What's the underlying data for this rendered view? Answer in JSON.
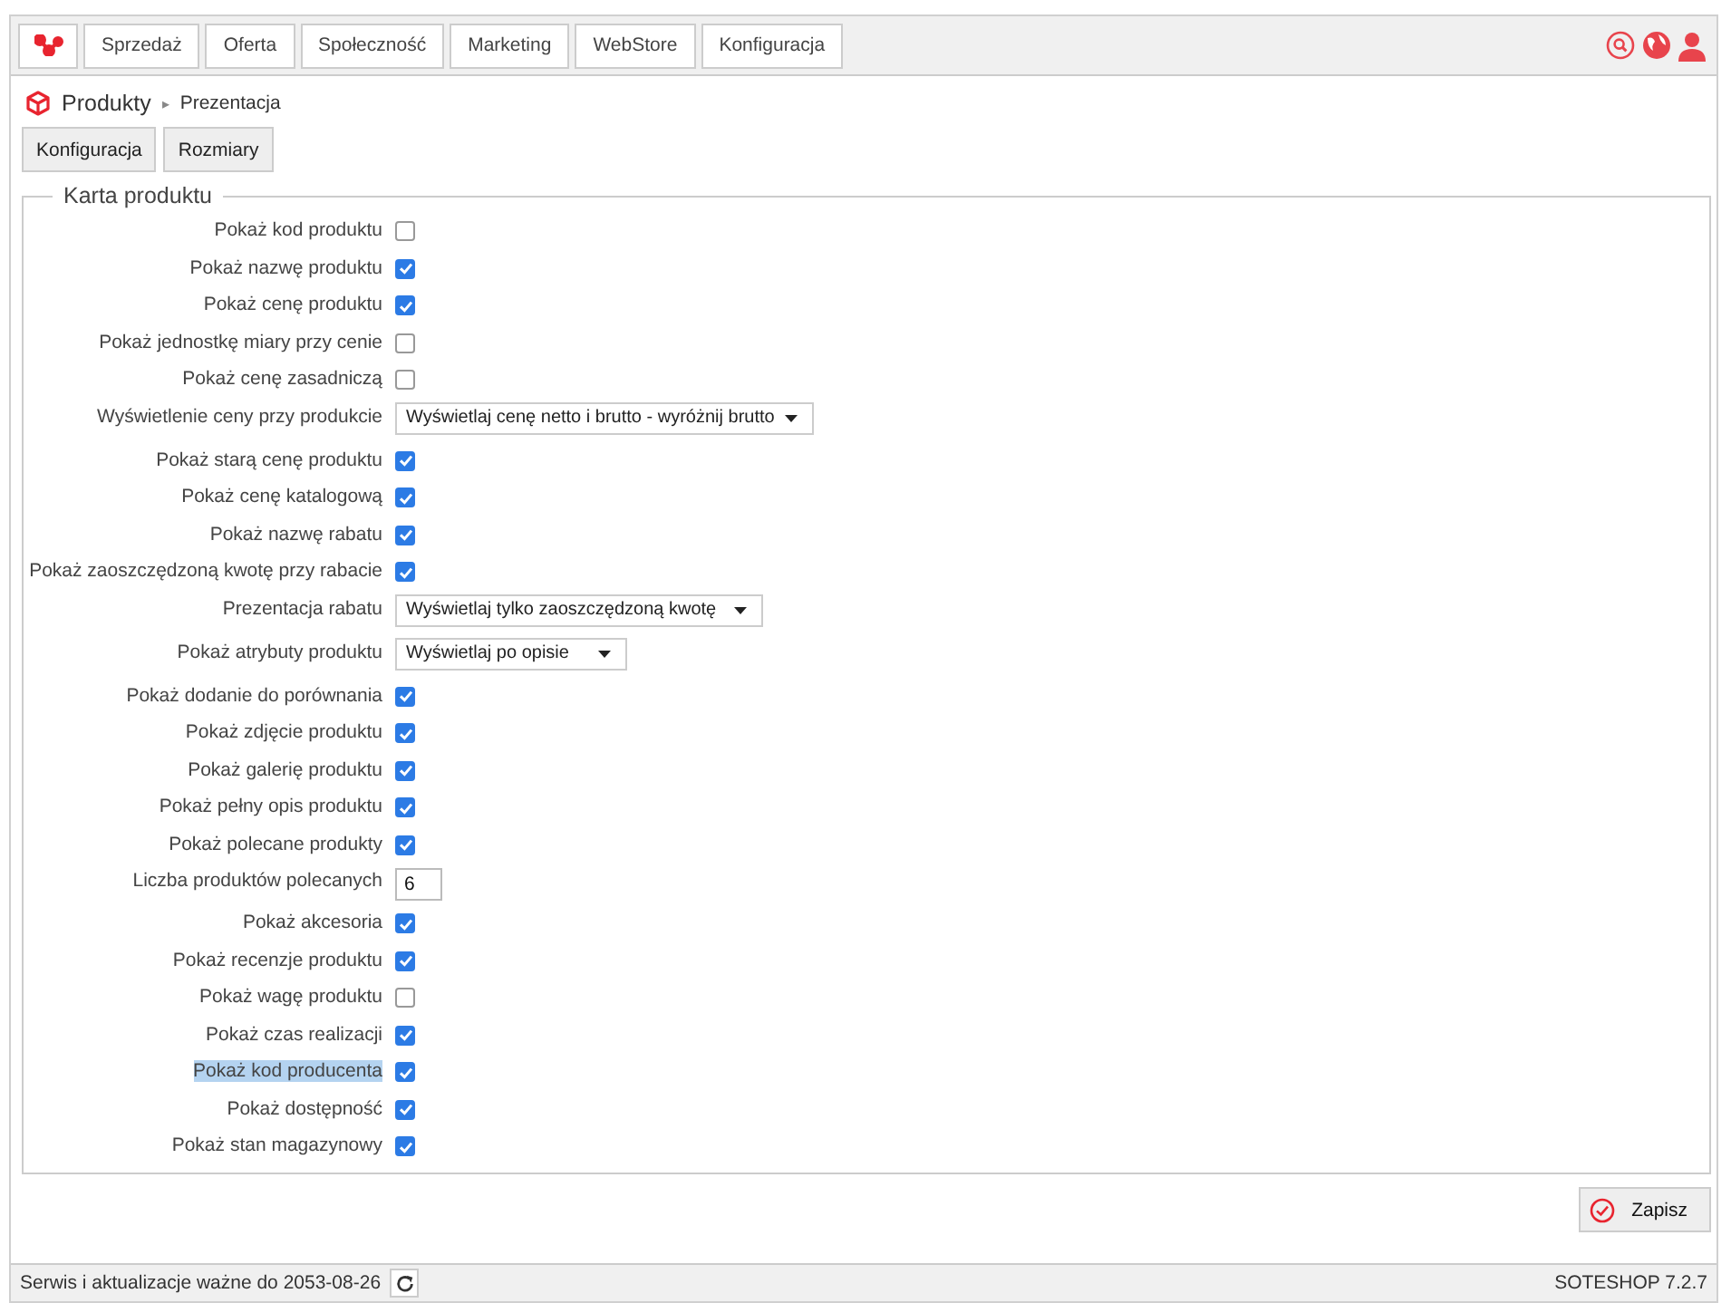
{
  "nav": {
    "items": [
      {
        "label": "Sprzedaż"
      },
      {
        "label": "Oferta"
      },
      {
        "label": "Społeczność"
      },
      {
        "label": "Marketing"
      },
      {
        "label": "WebStore"
      },
      {
        "label": "Konfiguracja"
      }
    ]
  },
  "breadcrumb": {
    "section": "Produkty",
    "separator": "▸",
    "page": "Prezentacja"
  },
  "subtabs": [
    {
      "label": "Konfiguracja"
    },
    {
      "label": "Rozmiary"
    }
  ],
  "fieldset": {
    "legend": "Karta produktu",
    "rows": [
      {
        "kind": "checkbox",
        "label": "Pokaż kod produktu",
        "checked": false,
        "highlighted": false
      },
      {
        "kind": "checkbox",
        "label": "Pokaż nazwę produktu",
        "checked": true,
        "highlighted": false
      },
      {
        "kind": "checkbox",
        "label": "Pokaż cenę produktu",
        "checked": true,
        "highlighted": false
      },
      {
        "kind": "checkbox",
        "label": "Pokaż jednostkę miary przy cenie",
        "checked": false,
        "highlighted": false
      },
      {
        "kind": "checkbox",
        "label": "Pokaż cenę zasadniczą",
        "checked": false,
        "highlighted": false
      },
      {
        "kind": "select",
        "label": "Wyświetlenie ceny przy produkcie",
        "value": "Wyświetlaj cenę netto i brutto - wyróżnij brutto",
        "highlighted": false
      },
      {
        "kind": "checkbox",
        "label": "Pokaż starą cenę produktu",
        "checked": true,
        "highlighted": false
      },
      {
        "kind": "checkbox",
        "label": "Pokaż cenę katalogową",
        "checked": true,
        "highlighted": false
      },
      {
        "kind": "checkbox",
        "label": "Pokaż nazwę rabatu",
        "checked": true,
        "highlighted": false
      },
      {
        "kind": "checkbox",
        "label": "Pokaż zaoszczędzoną kwotę przy rabacie",
        "checked": true,
        "highlighted": false
      },
      {
        "kind": "select",
        "label": "Prezentacja rabatu",
        "value": "Wyświetlaj tylko zaoszczędzoną kwotę",
        "highlighted": false
      },
      {
        "kind": "select",
        "label": "Pokaż atrybuty produktu",
        "value": "Wyświetlaj po opisie",
        "highlighted": false
      },
      {
        "kind": "checkbox",
        "label": "Pokaż dodanie do porównania",
        "checked": true,
        "highlighted": false
      },
      {
        "kind": "checkbox",
        "label": "Pokaż zdjęcie produktu",
        "checked": true,
        "highlighted": false
      },
      {
        "kind": "checkbox",
        "label": "Pokaż galerię produktu",
        "checked": true,
        "highlighted": false
      },
      {
        "kind": "checkbox",
        "label": "Pokaż pełny opis produktu",
        "checked": true,
        "highlighted": false
      },
      {
        "kind": "checkbox",
        "label": "Pokaż polecane produkty",
        "checked": true,
        "highlighted": false
      },
      {
        "kind": "number",
        "label": "Liczba produktów polecanych",
        "value": "6",
        "highlighted": false
      },
      {
        "kind": "checkbox",
        "label": "Pokaż akcesoria",
        "checked": true,
        "highlighted": false
      },
      {
        "kind": "checkbox",
        "label": "Pokaż recenzje produktu",
        "checked": true,
        "highlighted": false
      },
      {
        "kind": "checkbox",
        "label": "Pokaż wagę produktu",
        "checked": false,
        "highlighted": false
      },
      {
        "kind": "checkbox",
        "label": "Pokaż czas realizacji",
        "checked": true,
        "highlighted": false
      },
      {
        "kind": "checkbox",
        "label": "Pokaż kod producenta",
        "checked": true,
        "highlighted": true
      },
      {
        "kind": "checkbox",
        "label": "Pokaż dostępność",
        "checked": true,
        "highlighted": false
      },
      {
        "kind": "checkbox",
        "label": "Pokaż stan magazynowy",
        "checked": true,
        "highlighted": false
      }
    ]
  },
  "save_button": {
    "label": "Zapisz"
  },
  "status_bar": {
    "license": "Serwis i aktualizacje ważne do 2053-08-26",
    "version": "SOTESHOP 7.2.7"
  }
}
